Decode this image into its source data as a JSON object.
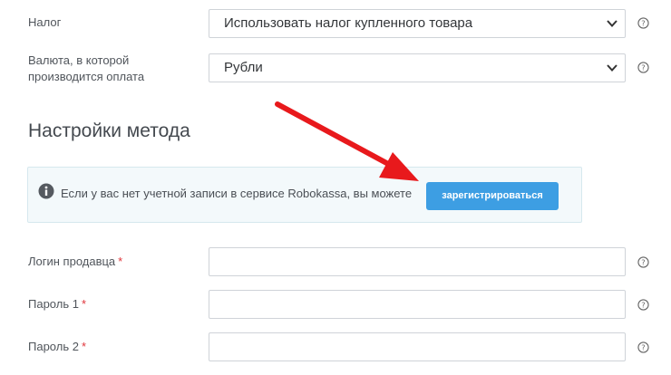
{
  "tax": {
    "label": "Налог",
    "value": "Использовать налог купленного товара"
  },
  "currency": {
    "label_line1": "Валюта, в которой",
    "label_line2": "производится оплата",
    "value": "Рубли"
  },
  "method_settings": {
    "title": "Настройки метода"
  },
  "info": {
    "text": "Если у вас нет учетной записи в сервисе Robokassa, вы можете",
    "register_button": "зарегистрироваться"
  },
  "fields": {
    "seller_login_label": "Логин продавца",
    "password1_label": "Пароль 1",
    "password2_label": "Пароль 2",
    "required_mark": "*"
  },
  "colors": {
    "button": "#3d9ee3",
    "arrow": "#e8191c",
    "required": "#e0353b",
    "info_bg": "#f3f9fb"
  }
}
